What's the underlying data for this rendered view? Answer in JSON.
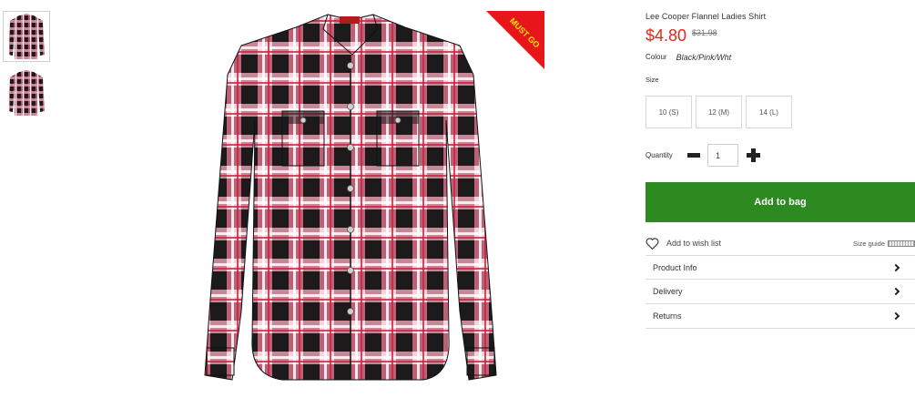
{
  "product": {
    "title": "Lee Cooper Flannel Ladies Shirt",
    "price": "$4.80",
    "was_price": "$31.98",
    "badge": "MUST GO",
    "colour_label": "Colour",
    "colour_value": "Black/Pink/Wht",
    "size_label": "Size",
    "sizes": [
      "10 (S)",
      "12 (M)",
      "14 (L)"
    ],
    "quantity_label": "Quantity",
    "quantity_value": "1",
    "add_to_bag": "Add to bag",
    "wish_list": "Add to wish list",
    "size_guide": "Size guide"
  },
  "accordion": [
    {
      "label": "Product Info"
    },
    {
      "label": "Delivery"
    },
    {
      "label": "Returns"
    }
  ],
  "colors": {
    "price": "#e8251c",
    "add_to_bag_bg": "#2c8a21",
    "badge_bg": "#e8161b",
    "badge_text": "#ffe600",
    "plaid_black": "#1c1a1b",
    "plaid_pink": "#d96c86",
    "plaid_red": "#c8203e"
  }
}
